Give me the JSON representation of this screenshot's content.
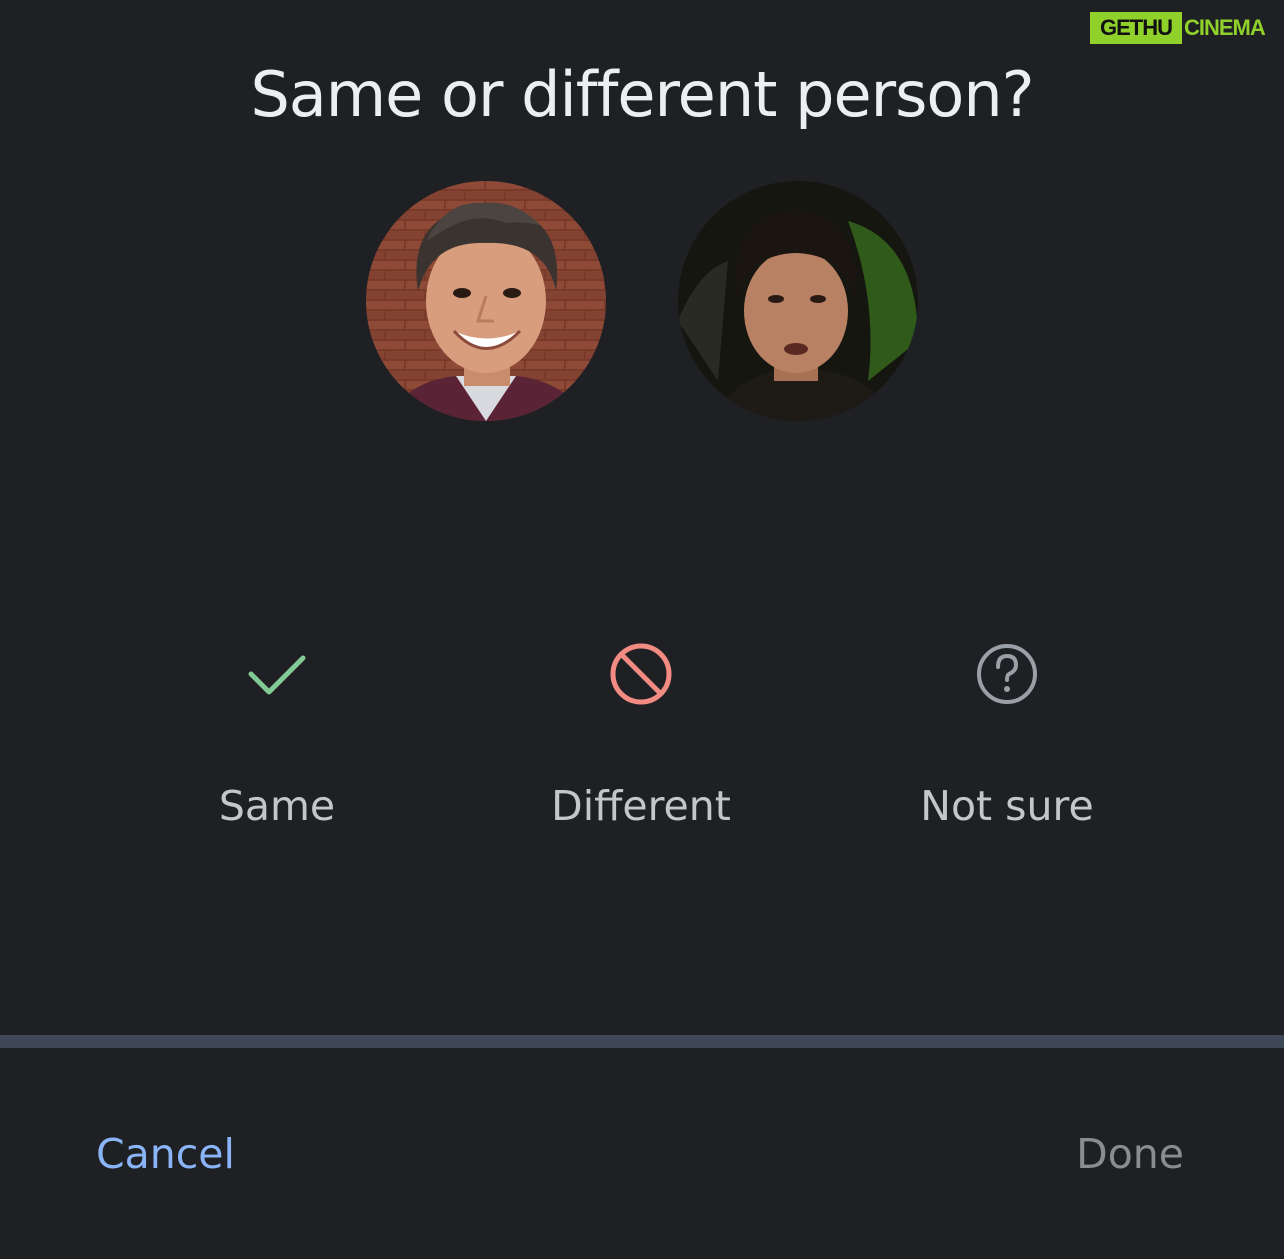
{
  "watermark": {
    "part1": "GETHU",
    "part2": "CINEMA"
  },
  "dialog": {
    "title": "Same or different person?"
  },
  "options": [
    {
      "label": "Same",
      "icon": "check-icon",
      "color": "#81c995"
    },
    {
      "label": "Different",
      "icon": "block-icon",
      "color": "#f28b82"
    },
    {
      "label": "Not sure",
      "icon": "help-circle-icon",
      "color": "#9aa0a6"
    }
  ],
  "actions": {
    "cancel_label": "Cancel",
    "done_label": "Done"
  },
  "colors": {
    "background": "#1f2024",
    "accent": "#8ab4f8",
    "divider": "#3d4756"
  }
}
